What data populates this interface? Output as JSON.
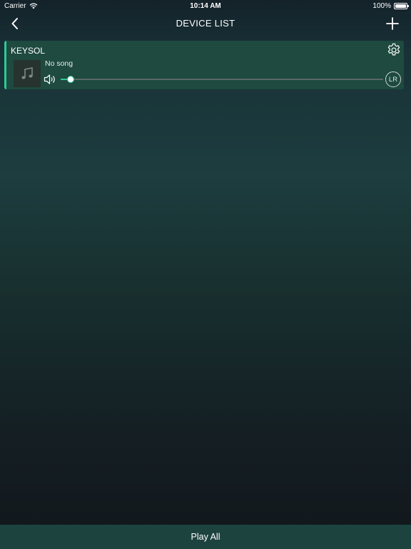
{
  "status_bar": {
    "carrier": "Carrier",
    "time": "10:14 AM",
    "battery": "100%"
  },
  "nav": {
    "title": "DEVICE LIST",
    "back_icon": "chevron-left-icon",
    "add_icon": "plus-icon"
  },
  "devices": [
    {
      "name": "KEYSOL",
      "song": "No song",
      "volume": 0.03,
      "channel": "LR",
      "settings_icon": "gear-icon",
      "art_icon": "music-note-icon"
    }
  ],
  "footer": {
    "play_all": "Play All"
  },
  "colors": {
    "accent": "#2ec995",
    "card": "#1e4a3f",
    "footer": "#1d433f"
  }
}
